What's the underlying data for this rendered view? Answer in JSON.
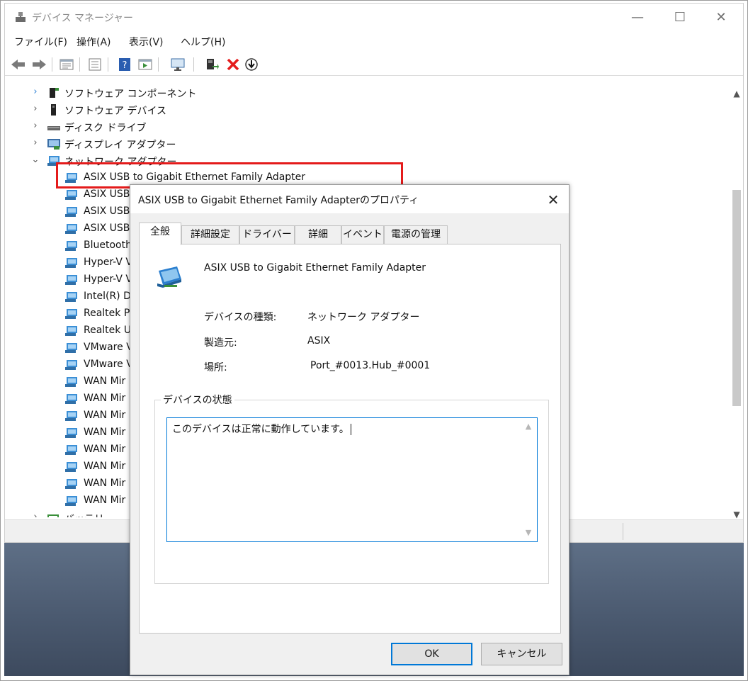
{
  "window": {
    "title": "デバイス マネージャー",
    "controls": {
      "minimize": "—",
      "maximize": "☐",
      "close": "✕"
    }
  },
  "menu": [
    "ファイル(F)",
    "操作(A)",
    "表示(V)",
    "ヘルプ(H)"
  ],
  "toolbar": {
    "icons": [
      "back-arrow-icon",
      "forward-arrow-icon",
      "properties-grid-icon",
      "list-view-icon",
      "help-icon",
      "run-icon",
      "monitor-icon",
      "add-driver-icon",
      "uninstall-x-icon",
      "update-download-icon"
    ],
    "uninstall_color": "#e41b1b"
  },
  "tree": {
    "categories": [
      {
        "label": "ソフトウェア コンポーネント",
        "arrow": "›",
        "expanded": false
      },
      {
        "label": "ソフトウェア デバイス",
        "arrow": "›",
        "expanded": false
      },
      {
        "label": "ディスク ドライブ",
        "arrow": "›",
        "expanded": false
      },
      {
        "label": "ディスプレイ アダプター",
        "arrow": "›",
        "expanded": false
      },
      {
        "label": "ネットワーク アダプター",
        "arrow": "⌄",
        "expanded": true
      }
    ],
    "network_adapters": [
      "ASIX USB to Gigabit Ethernet Family Adapter",
      "ASIX USB",
      "ASIX USB",
      "ASIX USB",
      "Bluetooth",
      "Hyper-V V",
      "Hyper-V V",
      "Intel(R) D",
      "Realtek P",
      "Realtek U",
      "VMware V",
      "VMware V",
      "WAN Mir",
      "WAN Mir",
      "WAN Mir",
      "WAN Mir",
      "WAN Mir",
      "WAN Mir",
      "WAN Mir",
      "WAN Mir"
    ],
    "last_category": {
      "label": "バッテリ",
      "arrow": "›"
    },
    "highlight_color": "#e41b1b"
  },
  "dialog": {
    "title": "ASIX USB to Gigabit Ethernet Family Adapterのプロパティ",
    "close": "✕",
    "tabs": [
      "全般",
      "詳細設定",
      "ドライバー",
      "詳細",
      "イベント",
      "電源の管理"
    ],
    "active_tab": "全般",
    "device_name": "ASIX USB to Gigabit Ethernet Family Adapter",
    "properties": [
      {
        "label": "デバイスの種類:",
        "value": "ネットワーク アダプター"
      },
      {
        "label": "製造元:",
        "value": "ASIX"
      },
      {
        "label": "場所:",
        "value": "Port_#0013.Hub_#0001"
      }
    ],
    "status_group_label": "デバイスの状態",
    "status_text": "このデバイスは正常に動作しています。",
    "ok_label": "OK",
    "cancel_label": "キャンセル",
    "focus_color": "#0078d7"
  }
}
